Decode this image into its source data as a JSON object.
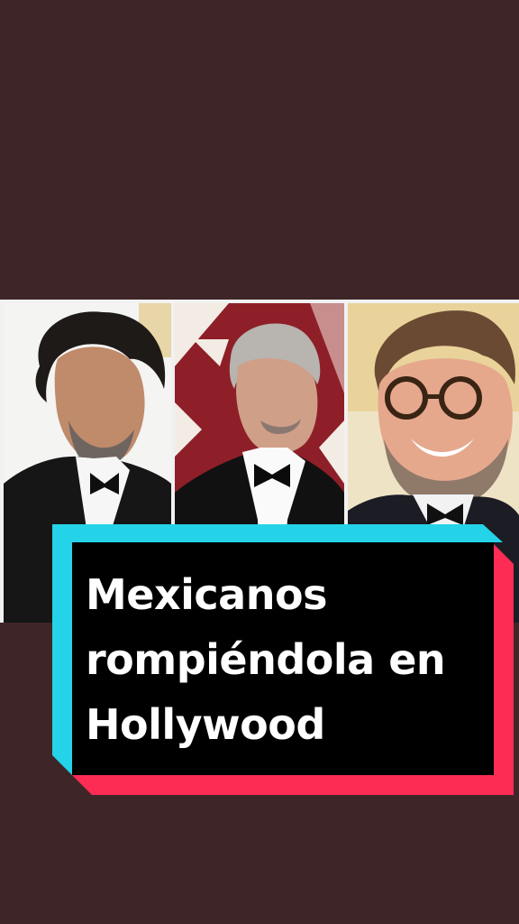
{
  "caption": {
    "lines": [
      "Mexicanos",
      "rompiéndola en",
      "Hollywood"
    ]
  },
  "photos": [
    {
      "subject": "man-with-curly-hair-in-tuxedo"
    },
    {
      "subject": "man-with-gray-hair-in-tuxedo"
    },
    {
      "subject": "smiling-man-with-glasses-and-beard"
    }
  ],
  "colors": {
    "background": "#3e2628",
    "caption_box": "#000000",
    "caption_text": "#ffffff",
    "accent_cyan": "#25d3e8",
    "accent_red": "#fc2c55"
  }
}
